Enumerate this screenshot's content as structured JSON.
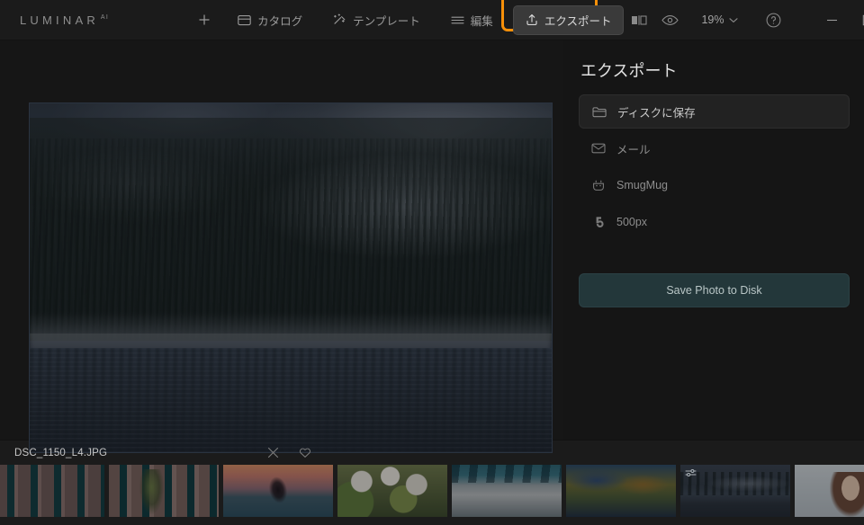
{
  "app": {
    "brand_name": "LUMINAR",
    "brand_superscript": "AI",
    "accent_highlight_color": "#f79009",
    "selection_color": "#2f7f93"
  },
  "toolbar": {
    "add_label": "",
    "catalog_label": "カタログ",
    "templates_label": "テンプレート",
    "edit_label": "編集",
    "export_label": "エクスポート",
    "zoom_level": "19%",
    "icons": {
      "add": "plus-icon",
      "catalog": "catalog-icon",
      "templates": "sparkle-icon",
      "edit": "sliders-icon",
      "export": "upload-icon",
      "compare": "compare-view-icon",
      "preview": "eye-icon",
      "zoom_chevron": "chevron-down-icon",
      "help": "question-mark-icon"
    }
  },
  "window_controls": {
    "minimize": "minimize-icon",
    "maximize": "maximize-icon",
    "close": "close-icon"
  },
  "export_panel": {
    "title": "エクスポート",
    "destinations": [
      {
        "label": "ディスクに保存",
        "icon": "folder-icon",
        "selected": true
      },
      {
        "label": "メール",
        "icon": "mail-icon",
        "selected": false
      },
      {
        "label": "SmugMug",
        "icon": "smugmug-icon",
        "selected": false
      },
      {
        "label": "500px",
        "icon": "500px-icon",
        "selected": false
      }
    ],
    "save_button_label": "Save Photo to Disk",
    "save_button_color": "#23373a"
  },
  "filmstrip": {
    "filename": "DSC_1150_L4.JPG",
    "close_icon": "close-icon",
    "favorite_icon": "heart-icon",
    "thumbnails": [
      {
        "name": "teal-building-facade",
        "art": "t-build",
        "selected": false,
        "adjusted": false
      },
      {
        "name": "building-with-tree",
        "art": "t-build2",
        "selected": false,
        "adjusted": false
      },
      {
        "name": "dancer-on-pier-sunset",
        "art": "t-dance",
        "selected": false,
        "adjusted": false
      },
      {
        "name": "white-blossom-flowers",
        "art": "t-flowers",
        "selected": false,
        "adjusted": false
      },
      {
        "name": "beach-with-people",
        "art": "t-beach",
        "selected": false,
        "adjusted": false
      },
      {
        "name": "autumn-lake-foliage",
        "art": "t-autumn",
        "selected": false,
        "adjusted": false
      },
      {
        "name": "misty-lake-forest",
        "art": "t-lake",
        "selected": true,
        "adjusted": true
      },
      {
        "name": "portrait-smiling-woman",
        "art": "t-portrait",
        "selected": false,
        "adjusted": false
      }
    ]
  },
  "canvas": {
    "photo_alt": "misty-forest-lake-photo"
  }
}
